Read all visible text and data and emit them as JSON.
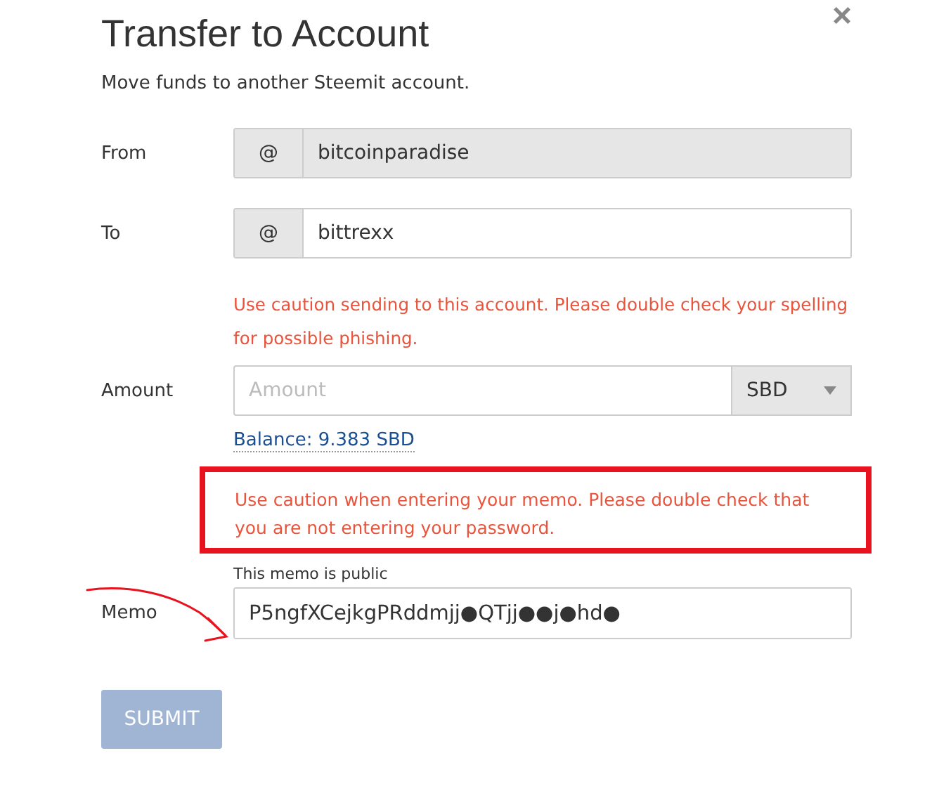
{
  "dialog": {
    "title": "Transfer to Account",
    "subtitle": "Move funds to another Steemit account.",
    "close": "×"
  },
  "from": {
    "label": "From",
    "prefix": "@",
    "value": "bitcoinparadise",
    "disabled": true
  },
  "to": {
    "label": "To",
    "prefix": "@",
    "value": "bittrexx",
    "disabled": false,
    "warning": "Use caution sending to this account. Please double check your spelling for possible phishing."
  },
  "amount": {
    "label": "Amount",
    "placeholder": "Amount",
    "asset": "SBD",
    "balance": "Balance: 9.383 SBD"
  },
  "memo_warning": "Use caution when entering your memo. Please double check that you are not entering your password.",
  "memo": {
    "label": "Memo",
    "hint": "This memo is public",
    "value": "P5ngfXCejkgPRddmjj●QTjj●●j●hd●"
  },
  "submit": {
    "label": "SUBMIT",
    "disabled": true
  }
}
